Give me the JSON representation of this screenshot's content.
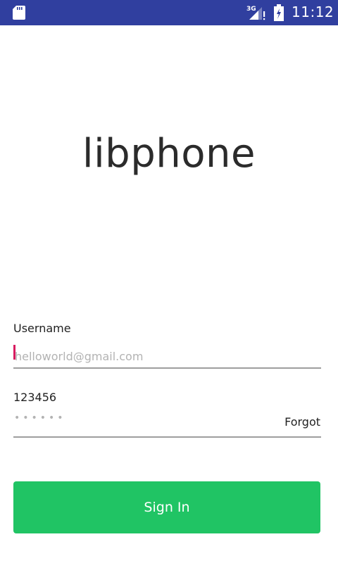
{
  "status_bar": {
    "time": "11:12",
    "network_type": "3G",
    "background_color": "#303f9f",
    "icons": [
      "sd-card-icon",
      "signal-icon",
      "battery-icon"
    ]
  },
  "app": {
    "title": "libphone"
  },
  "form": {
    "username_label": "Username",
    "username_placeholder": "helloworld@gmail.com",
    "password_label": "123456",
    "password_mask": "••••••",
    "forgot_label": "Forgot",
    "signin_label": "Sign In",
    "accent_color": "#20c464",
    "cursor_color": "#d81b60"
  }
}
